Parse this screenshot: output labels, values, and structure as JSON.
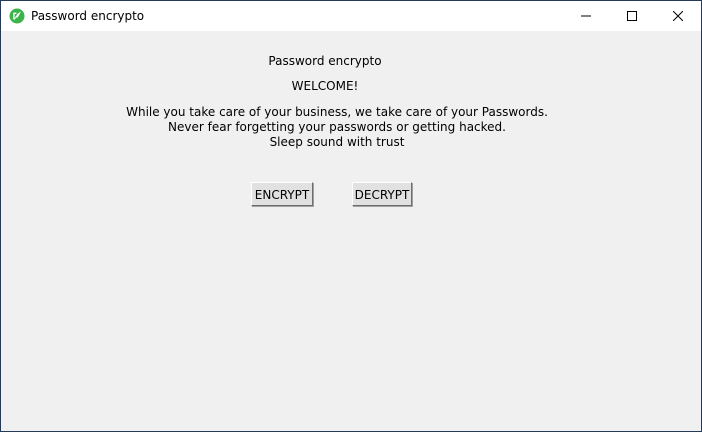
{
  "window": {
    "title": "Password encrypto",
    "icon": "python-feather-icon",
    "controls": {
      "minimize": "minimize-icon",
      "maximize": "maximize-icon",
      "close": "close-icon"
    }
  },
  "main": {
    "heading": "Password encrypto",
    "welcome": "WELCOME!",
    "tagline": [
      "While you take care of your business, we take care of your Passwords.",
      "Never fear forgetting your passwords or getting hacked.",
      "Sleep sound with trust"
    ],
    "buttons": {
      "encrypt": "ENCRYPT",
      "decrypt": "DECRYPT"
    }
  },
  "colors": {
    "client_bg": "#f0f0f0",
    "titlebar_bg": "#ffffff",
    "icon_green": "#3bb54a"
  }
}
